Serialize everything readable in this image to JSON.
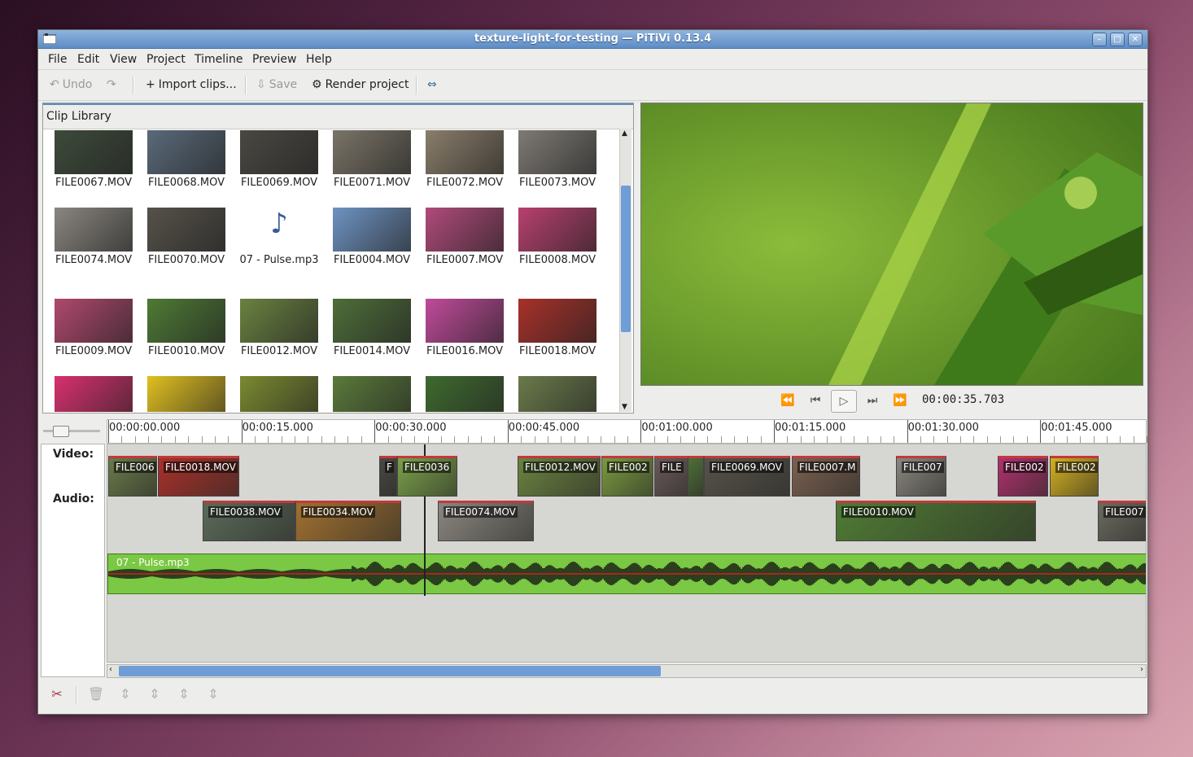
{
  "window": {
    "title": "texture-light-for-testing — PiTiVi 0.13.4"
  },
  "menu": [
    "File",
    "Edit",
    "View",
    "Project",
    "Timeline",
    "Preview",
    "Help"
  ],
  "toolbar": {
    "undo": "Undo",
    "import": "Import clips...",
    "save": "Save",
    "render": "Render project"
  },
  "library": {
    "title": "Clip Library",
    "clips": [
      {
        "name": "FILE0067.MOV",
        "color": "#3d4a3a"
      },
      {
        "name": "FILE0068.MOV",
        "color": "#5a6a7a"
      },
      {
        "name": "FILE0069.MOV",
        "color": "#4a4842"
      },
      {
        "name": "FILE0071.MOV",
        "color": "#7a7468"
      },
      {
        "name": "FILE0072.MOV",
        "color": "#8a7e6a"
      },
      {
        "name": "FILE0073.MOV",
        "color": "#7e7a74"
      },
      {
        "name": "FILE0074.MOV",
        "color": "#8a8680"
      },
      {
        "name": "FILE0070.MOV",
        "color": "#56524a"
      },
      {
        "name": "07 - Pulse.mp3",
        "color": "audio"
      },
      {
        "name": "FILE0004.MOV",
        "color": "#6e93c2"
      },
      {
        "name": "FILE0007.MOV",
        "color": "#b04a7a"
      },
      {
        "name": "FILE0008.MOV",
        "color": "#b8406e"
      },
      {
        "name": "FILE0009.MOV",
        "color": "#b0486e"
      },
      {
        "name": "FILE0010.MOV",
        "color": "#4e7a34"
      },
      {
        "name": "FILE0012.MOV",
        "color": "#6a8240"
      },
      {
        "name": "FILE0014.MOV",
        "color": "#4e6e38"
      },
      {
        "name": "FILE0016.MOV",
        "color": "#c04a9a"
      },
      {
        "name": "FILE0018.MOV",
        "color": "#a8302a"
      },
      {
        "name": "",
        "color": "#d8306e"
      },
      {
        "name": "",
        "color": "#e0c020"
      },
      {
        "name": "",
        "color": "#7a8a30"
      },
      {
        "name": "",
        "color": "#5a7a3a"
      },
      {
        "name": "",
        "color": "#3e6a2e"
      },
      {
        "name": "",
        "color": "#6a7a4a"
      }
    ]
  },
  "preview": {
    "timecode": "00:00:35.703"
  },
  "ruler": {
    "labels": [
      "00:00:00.000",
      "00:00:15.000",
      "00:00:30.000",
      "00:00:45.000",
      "00:01:00.000",
      "00:01:15.000",
      "00:01:30.000",
      "00:01:45.000"
    ]
  },
  "tracks": {
    "video_label": "Video:",
    "audio_label": "Audio:",
    "row1": [
      {
        "name": "FILE006",
        "color": "#6a7a4a"
      },
      {
        "name": "FILE0018.MOV",
        "color": "#a8302a"
      },
      {
        "name": "F",
        "color": "#4a4842"
      },
      {
        "name": "FILE0036",
        "color": "#7aa04a"
      },
      {
        "name": "FILE0012.MOV",
        "color": "#6a8240"
      },
      {
        "name": "FILE002",
        "color": "#7a9a40"
      },
      {
        "name": "FILE",
        "color": "#6a5a5a"
      },
      {
        "name": "",
        "color": "#4e6e38"
      },
      {
        "name": "FILE0069.MOV",
        "color": "#56524a"
      },
      {
        "name": "FILE0007.M",
        "color": "#7a6050"
      },
      {
        "name": "FILE007",
        "color": "#8a8680"
      },
      {
        "name": "FILE002",
        "color": "#b0306e"
      },
      {
        "name": "FILE002",
        "color": "#d4b020"
      }
    ],
    "row2": [
      {
        "name": "FILE0038.MOV",
        "color": "#5a6a5a"
      },
      {
        "name": "FILE0034.MOV",
        "color": "#a07030"
      },
      {
        "name": "FILE0074.MOV",
        "color": "#8a8680"
      },
      {
        "name": "FILE0010.MOV",
        "color": "#4e7a34"
      },
      {
        "name": "FILE007",
        "color": "#6a6a60"
      }
    ],
    "audio_clip": "07 - Pulse.mp3"
  }
}
